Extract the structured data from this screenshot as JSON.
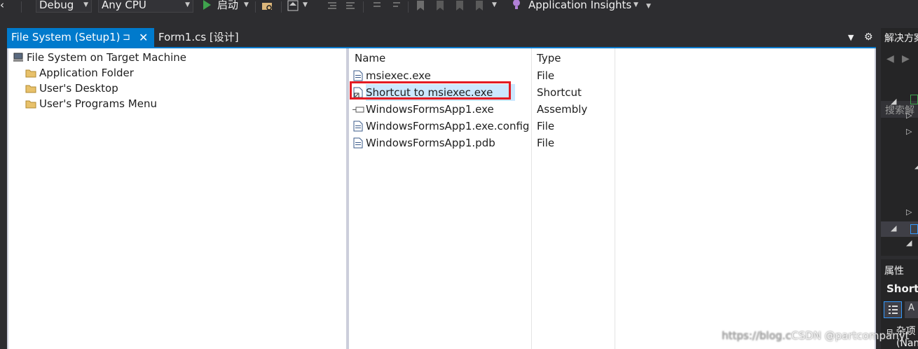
{
  "toolbar": {
    "config": "Debug",
    "platform": "Any CPU",
    "start_label": "启动",
    "insights_label": "Application Insights"
  },
  "tabs": [
    {
      "label": "File System (Setup1)",
      "pin": "⊐",
      "close": "✕"
    },
    {
      "label": "Form1.cs [设计]"
    }
  ],
  "tree": {
    "root": "File System on Target Machine",
    "items": [
      "Application Folder",
      "User's Desktop",
      "User's Programs Menu"
    ]
  },
  "files": {
    "headers": {
      "name": "Name",
      "type": "Type"
    },
    "rows": [
      {
        "name": "msiexec.exe",
        "type": "File",
        "icon": "file-icon"
      },
      {
        "name": "Shortcut to msiexec.exe",
        "type": "Shortcut",
        "icon": "shortcut-icon"
      },
      {
        "name": "WindowsFormsApp1.exe",
        "type": "Assembly",
        "icon": "assembly-icon"
      },
      {
        "name": "WindowsFormsApp1.exe.config",
        "type": "File",
        "icon": "file-icon"
      },
      {
        "name": "WindowsFormsApp1.pdb",
        "type": "File",
        "icon": "file-icon"
      }
    ],
    "selected_index": 1
  },
  "solution_explorer": {
    "title": "解决方案",
    "search_placeholder": "搜索解"
  },
  "properties": {
    "title": "属性",
    "object": "Shortc",
    "category": "杂项",
    "first_prop": "(Nam"
  },
  "watermark": {
    "faint": "https://blog.c",
    "main": "CSDN @partcompanyt"
  },
  "colors": {
    "accent": "#007acc",
    "highlight_box": "#e31b23",
    "selection": "#cce8ff"
  }
}
